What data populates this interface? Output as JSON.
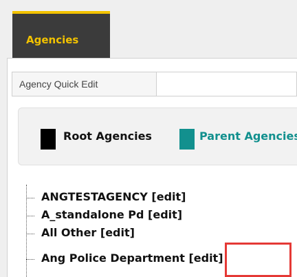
{
  "tabs": [
    {
      "label": "Agencies",
      "active": true
    }
  ],
  "quick_edit": {
    "label": "Agency Quick Edit",
    "value": "",
    "placeholder": ""
  },
  "legend": {
    "root_label": "Root Agencies",
    "parent_label": "Parent Agencies",
    "root_color": "#000000",
    "parent_color": "#12908e"
  },
  "tree": [
    {
      "name": "ANGTESTAGENCY",
      "edit": "[edit]"
    },
    {
      "name": "A_standalone Pd",
      "edit": "[edit]"
    },
    {
      "name": "All Other",
      "edit": "[edit]"
    },
    {
      "name": "Ang Police Department",
      "edit": "[edit]"
    }
  ],
  "colors": {
    "tab_accent": "#f2c200",
    "tab_bg": "#3b3b3b",
    "highlight": "#e53935"
  }
}
